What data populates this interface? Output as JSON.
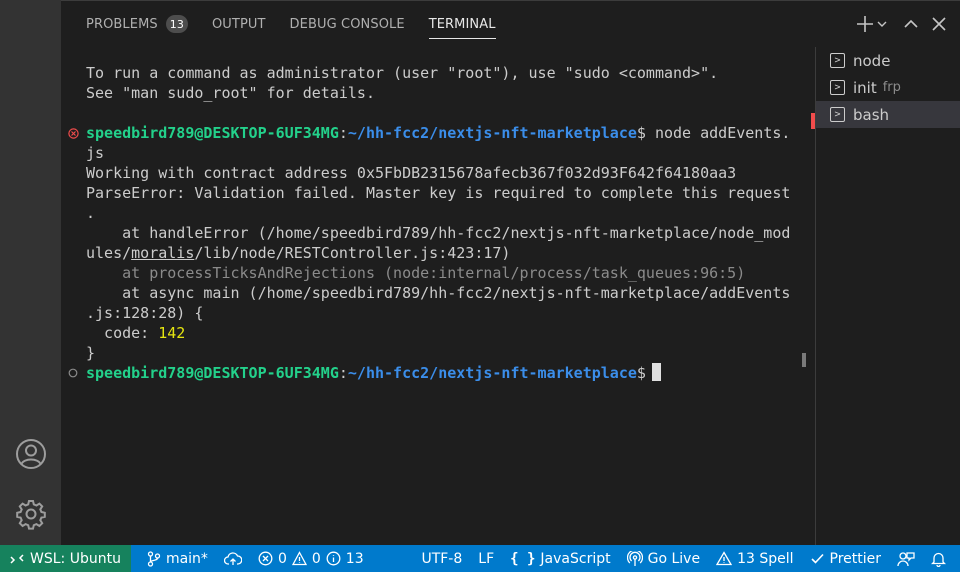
{
  "panel": {
    "tabs": [
      {
        "label": "PROBLEMS",
        "badge": "13"
      },
      {
        "label": "OUTPUT"
      },
      {
        "label": "DEBUG CONSOLE"
      },
      {
        "label": "TERMINAL",
        "active": true
      }
    ]
  },
  "terminal": {
    "lines": [
      "To run a command as administrator (user \"root\"), use \"sudo <command>\".",
      "See \"man sudo_root\" for details.",
      "",
      "",
      "js",
      "Working with contract address 0x5FbDB2315678afecb367f032d93F642f64180aa3",
      "ParseError: Validation failed. Master key is required to complete this request",
      ".",
      "    at handleError (/home/speedbird789/hh-fcc2/nextjs-nft-marketplace/node_mod",
      "ules/",
      "    at processTicksAndRejections (node:internal/process/task_queues:96:5)",
      "    at async main (/home/speedbird789/hh-fcc2/nextjs-nft-marketplace/addEvents",
      ".js:128:28) {",
      "  code: ",
      "}"
    ],
    "underlined_word": "moralis",
    "after_underline": "/lib/node/RESTController.js:423:17)",
    "code_value": "142",
    "prompt_user": "speedbird789@DESKTOP-6UF34MG",
    "prompt_sep": ":",
    "prompt_path": "~/hh-fcc2/nextjs-nft-marketplace",
    "prompt_dollar": "$",
    "command1": " node addEvents.",
    "command2": " "
  },
  "terminal_list": [
    {
      "name": "node",
      "sub": ""
    },
    {
      "name": "init",
      "sub": "frp"
    },
    {
      "name": "bash",
      "sub": "",
      "active": true
    }
  ],
  "statusbar": {
    "remote": "WSL: Ubuntu",
    "branch": "main*",
    "errors": "0",
    "warnings": "0",
    "infos": "13",
    "encoding": "UTF-8",
    "eol": "LF",
    "language": "JavaScript",
    "golive": "Go Live",
    "spell": "13 Spell",
    "prettier": "Prettier"
  },
  "colors": {
    "statusbar": "#007acc",
    "remote": "#16825d",
    "prompt_user": "#23d18b",
    "prompt_path": "#3b8eea",
    "error": "#f14c4c",
    "number": "#e5e510"
  }
}
